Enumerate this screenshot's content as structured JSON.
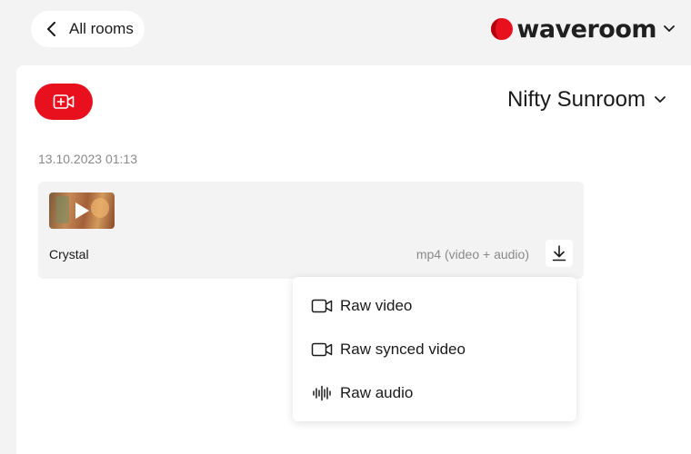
{
  "nav": {
    "back_label": "All rooms",
    "back_icon": "chevron-left-icon"
  },
  "brand": {
    "name": "waveroom",
    "logo_color": "#e8101c",
    "menu_icon": "chevron-down-icon"
  },
  "toolbar": {
    "record_icon": "video-add-icon",
    "record_color": "#e8101c"
  },
  "room": {
    "name": "Nifty Sunroom",
    "menu_icon": "chevron-down-icon"
  },
  "recordings": [
    {
      "date": "13.10.2023 01:13",
      "name": "Crystal",
      "format": "mp4 (video + audio)",
      "thumb_icon": "play-icon",
      "download_icon": "download-icon"
    }
  ],
  "download_menu": {
    "items": [
      {
        "label": "Raw video",
        "icon": "video-camera-icon"
      },
      {
        "label": "Raw synced video",
        "icon": "video-camera-icon"
      },
      {
        "label": "Raw audio",
        "icon": "audio-waveform-icon"
      }
    ]
  }
}
